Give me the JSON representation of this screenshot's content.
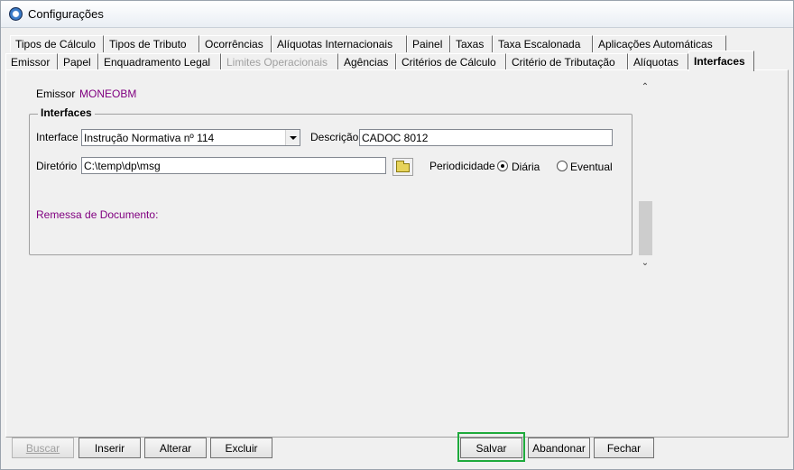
{
  "window": {
    "title": "Configurações"
  },
  "tabs_row1": [
    "Tipos de Cálculo",
    "Tipos de Tributo",
    "Ocorrências",
    "Alíquotas Internacionais",
    "Painel",
    "Taxas",
    "Taxa Escalonada",
    "Aplicações Automáticas"
  ],
  "tabs_row2": [
    "Emissor",
    "Papel",
    "Enquadramento Legal",
    "Limites Operacionais",
    "Agências",
    "Critérios de Cálculo",
    "Critério de Tributação",
    "Alíquotas",
    "Interfaces"
  ],
  "emissor": {
    "label": "Emissor",
    "value": "MONEOBM"
  },
  "interfaces_group": {
    "title": "Interfaces",
    "interface_label": "Interface",
    "interface_value": "Instrução Normativa nº 114",
    "descricao_label": "Descrição",
    "descricao_value": "CADOC 8012",
    "diretorio_label": "Diretório",
    "diretorio_value": "C:\\temp\\dp\\msg",
    "periodicidade_label": "Periodicidade",
    "option_diaria": "Diária",
    "option_eventual": "Eventual",
    "remessa_label": "Remessa de Documento:"
  },
  "buttons": {
    "buscar": "Buscar",
    "inserir": "Inserir",
    "alterar": "Alterar",
    "excluir": "Excluir",
    "salvar": "Salvar",
    "abandonar": "Abandonar",
    "fechar": "Fechar"
  },
  "colors": {
    "accent_purple": "#800080",
    "highlight_green": "#1eaa3c"
  }
}
